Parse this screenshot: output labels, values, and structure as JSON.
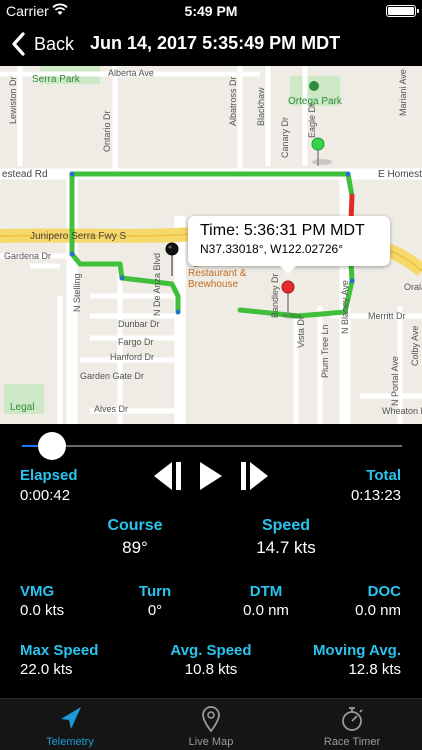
{
  "status_bar": {
    "carrier": "Carrier",
    "time": "5:49 PM"
  },
  "nav": {
    "back_label": "Back",
    "title": "Jun 14, 2017 5:35:49 PM MDT"
  },
  "map": {
    "labels": {
      "serra_park": "Serra Park",
      "alberta_ave": "Alberta Ave",
      "ortega_park": "Ortega Park",
      "homestead_left": "estead Rd",
      "homestead_right": "E Homest",
      "junipero": "Junipero Serra Fwy S",
      "gardena": "Gardena Dr",
      "restaurant": "Restaurant &\nBrewhouse",
      "dunbar": "Dunbar Dr",
      "fargo": "Fargo Dr",
      "hanford": "Hanford Dr",
      "garden_gate": "Garden Gate Dr",
      "alves": "Alves Dr",
      "legal": "Legal",
      "merritt": "Merritt Dr",
      "colby": "Colby Ave",
      "wheaton": "Wheaton D",
      "portal": "N Portal Ave",
      "de_anza": "N De Anza Blvd",
      "blaney": "N Blaney Ave",
      "stelling": "N Stelling",
      "vista": "Vista Dr",
      "plum_tree": "Plum Tree Ln",
      "ontario": "Ontario Dr",
      "albatross": "Albatross Dr",
      "canary": "Canary Dr",
      "eagle": "Eagle Dr",
      "blackhaw": "Blackhaw",
      "lewiston": "Lewiston Dr",
      "bandley": "Bandley Dr",
      "orala": "Orala",
      "mariani": "Mariani Ave"
    },
    "callout": {
      "time": "Time: 5:36:31 PM MDT",
      "coords": "N37.33018°, W122.02726°"
    }
  },
  "playback": {
    "progress": 0.08
  },
  "stats": {
    "elapsed": {
      "label": "Elapsed",
      "value": "0:00:42"
    },
    "total": {
      "label": "Total",
      "value": "0:13:23"
    },
    "course": {
      "label": "Course",
      "value": "89°"
    },
    "speed": {
      "label": "Speed",
      "value": "14.7 kts"
    },
    "vmg": {
      "label": "VMG",
      "value": "0.0 kts"
    },
    "turn": {
      "label": "Turn",
      "value": "0°"
    },
    "dtm": {
      "label": "DTM",
      "value": "0.0 nm"
    },
    "doc": {
      "label": "DOC",
      "value": "0.0 nm"
    },
    "max_speed": {
      "label": "Max Speed",
      "value": "22.0 kts"
    },
    "avg_speed": {
      "label": "Avg. Speed",
      "value": "10.8 kts"
    },
    "moving_avg": {
      "label": "Moving Avg.",
      "value": "12.8 kts"
    }
  },
  "tabs": [
    {
      "label": "Telemetry",
      "icon": "location-arrow-icon",
      "active": true
    },
    {
      "label": "Live Map",
      "icon": "map-pin-icon",
      "active": false
    },
    {
      "label": "Race Timer",
      "icon": "stopwatch-icon",
      "active": false
    }
  ],
  "colors": {
    "accent": "#2ac3ee",
    "active_tab": "#1e9bd7",
    "inactive_tab": "#9a9a9a",
    "track_green": "#3fbf3a",
    "track_red": "#e02a2a",
    "slider_fill": "#1a7bff"
  }
}
